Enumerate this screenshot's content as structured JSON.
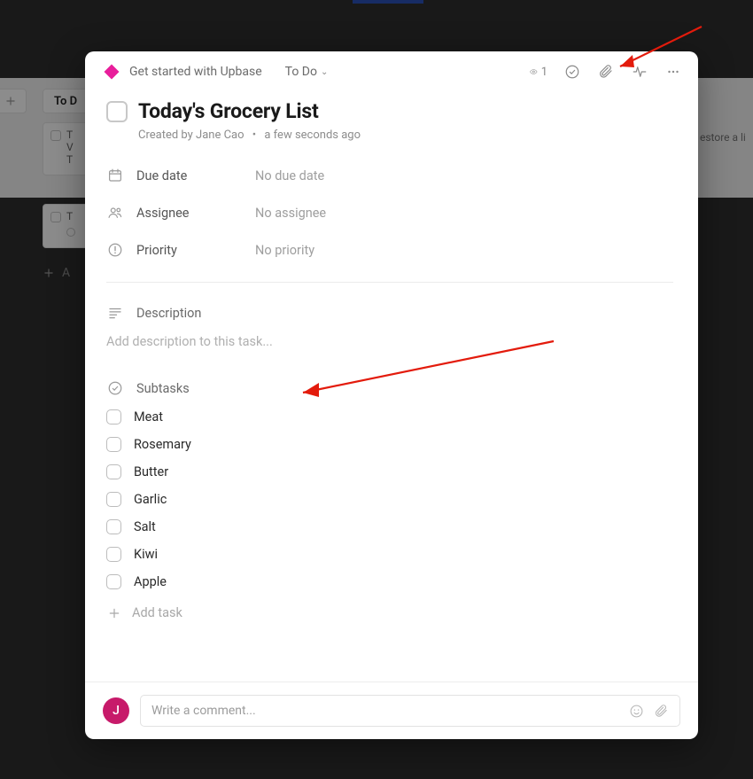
{
  "background": {
    "column_header": "To D",
    "card1_lines": [
      "T",
      "V",
      "T"
    ],
    "card2_lines": [
      "T"
    ],
    "restore_text": "estore a li",
    "add_task_text": "A"
  },
  "header": {
    "brand": "Get started with Upbase",
    "status": "To Do",
    "watch_count": "1"
  },
  "task": {
    "title": "Today's Grocery List",
    "created_by_prefix": "Created by ",
    "created_by_name": "Jane Cao",
    "time": "a few seconds ago"
  },
  "fields": {
    "due_date": {
      "label": "Due date",
      "value": "No due date"
    },
    "assignee": {
      "label": "Assignee",
      "value": "No assignee"
    },
    "priority": {
      "label": "Priority",
      "value": "No priority"
    }
  },
  "description": {
    "label": "Description",
    "placeholder": "Add description to this task..."
  },
  "subtasks": {
    "label": "Subtasks",
    "items": [
      "Meat",
      "Rosemary",
      "Butter",
      "Garlic",
      "Salt",
      "Kiwi",
      "Apple"
    ],
    "add_label": "Add task"
  },
  "comment": {
    "avatar_initial": "J",
    "placeholder": "Write a comment..."
  }
}
